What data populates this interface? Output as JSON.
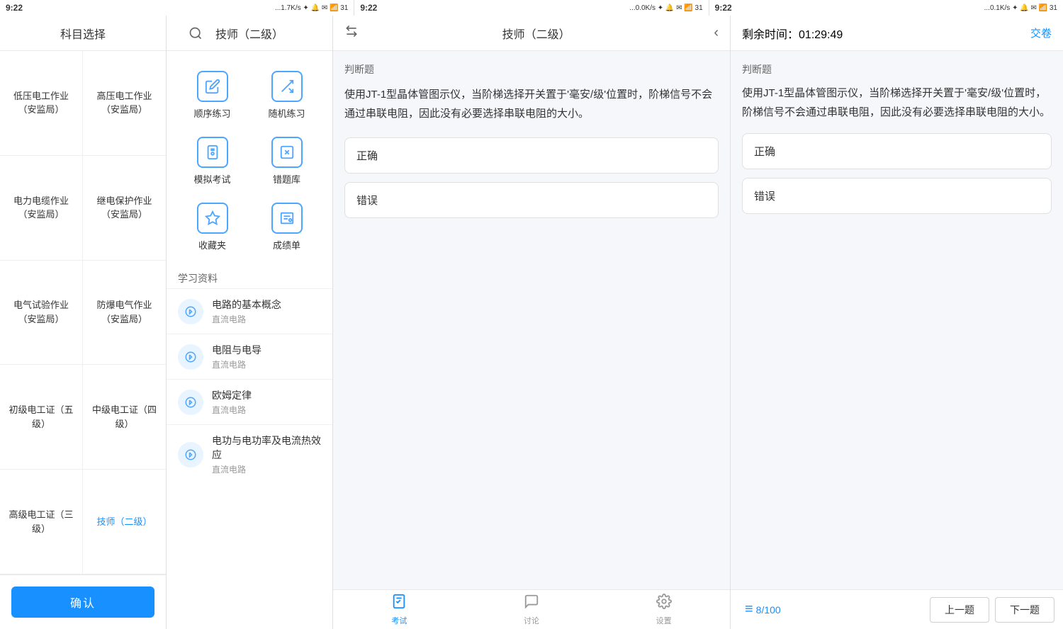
{
  "statusBars": [
    {
      "time": "9:22",
      "signal": "...1.7K/s ✦ 🔔 ✉ 📶 31"
    },
    {
      "time": "9:22",
      "signal": "...0.0K/s ✦ 🔔 ✉ 📶 31"
    },
    {
      "time": "9:22",
      "signal": "...0.1K/s ✦ 🔔 ✉ 📶 31"
    }
  ],
  "panel1": {
    "title": "科目选择",
    "subjects": [
      {
        "label": "低压电工作业（安监局）"
      },
      {
        "label": "高压电工作业（安监局）"
      },
      {
        "label": "电力电缆作业（安监局）"
      },
      {
        "label": "继电保护作业（安监局）"
      },
      {
        "label": "电气试验作业（安监局）"
      },
      {
        "label": "防爆电气作业（安监局）"
      },
      {
        "label": "初级电工证（五级）"
      },
      {
        "label": "中级电工证（四级）"
      },
      {
        "label": "高级电工证（三级）",
        "active": false
      },
      {
        "label": "技师（二级）",
        "active": true
      }
    ],
    "confirmLabel": "确认"
  },
  "panel2": {
    "title": "技师（二级）",
    "practiceItems": [
      {
        "label": "顺序练习",
        "icon": "pencil"
      },
      {
        "label": "随机练习",
        "icon": "shuffle"
      },
      {
        "label": "模拟考试",
        "icon": "exam"
      },
      {
        "label": "错题库",
        "icon": "error"
      },
      {
        "label": "收藏夹",
        "icon": "star"
      },
      {
        "label": "成绩单",
        "icon": "score"
      }
    ],
    "sectionTitle": "学习资料",
    "studyMaterials": [
      {
        "main": "电路的基本概念",
        "sub": "直流电路"
      },
      {
        "main": "电阻与电导",
        "sub": "直流电路"
      },
      {
        "main": "欧姆定律",
        "sub": "直流电路"
      },
      {
        "main": "电功与电功率及电流热效应",
        "sub": "直流电路"
      }
    ]
  },
  "panel3": {
    "title": "技师（二级）",
    "questionType": "判断题",
    "questionText": "使用JT-1型晶体管图示仪，当阶梯选择开关置于'毫安/级'位置时，阶梯信号不会通过串联电阻，因此没有必要选择串联电阻的大小。",
    "options": [
      {
        "label": "正确"
      },
      {
        "label": "错误"
      }
    ],
    "tabs": [
      {
        "label": "考试",
        "icon": "📋",
        "active": true
      },
      {
        "label": "讨论",
        "icon": "💬",
        "active": false
      },
      {
        "label": "设置",
        "icon": "⚙",
        "active": false
      }
    ]
  },
  "panel4": {
    "timerLabel": "剩余时间：",
    "timerValue": "01:29:49",
    "submitLabel": "交卷",
    "questionType": "判断题",
    "questionText": "使用JT-1型晶体管图示仪，当阶梯选择开关置于'毫安/级'位置时，阶梯信号不会通过串联电阻，因此没有必要选择串联电阻的大小。",
    "options": [
      {
        "label": "正确"
      },
      {
        "label": "错误"
      }
    ],
    "currentCard": "8/100",
    "prevLabel": "上一题",
    "nextLabel": "下一题",
    "backIcon": "‹"
  }
}
